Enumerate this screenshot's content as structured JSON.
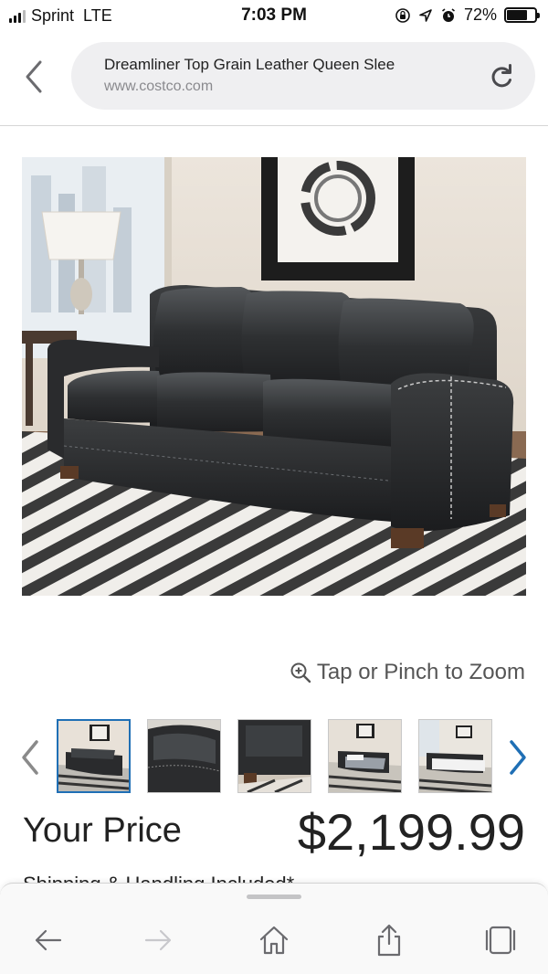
{
  "status_bar": {
    "carrier": "Sprint",
    "network": "LTE",
    "time": "7:03 PM",
    "battery_percent": "72%",
    "battery_level": 0.72,
    "icons": [
      "signal-icon",
      "orientation-lock-icon",
      "location-arrow-icon",
      "alarm-icon",
      "battery-icon"
    ]
  },
  "browser": {
    "page_title": "Dreamliner Top Grain Leather Queen Slee",
    "domain": "www.costco.com",
    "icons": {
      "back": "chevron-left-icon",
      "reload": "reload-icon"
    }
  },
  "product": {
    "image_alt": "black leather sleeper sofa",
    "zoom_hint": "Tap or Pinch to Zoom",
    "thumbnail_count": 5,
    "selected_thumbnail": 1,
    "price_label": "Your Price",
    "price": "$2,199.99",
    "shipping_note": "Shipping & Handling Included*"
  },
  "toolbar": {
    "items": [
      "back-arrow-icon",
      "forward-arrow-icon",
      "home-icon",
      "share-icon",
      "tabs-icon"
    ]
  },
  "colors": {
    "accent": "#1f6fb5",
    "text": "#222222",
    "muted": "#8a8a8e",
    "url_bar_bg": "#efeff1"
  }
}
